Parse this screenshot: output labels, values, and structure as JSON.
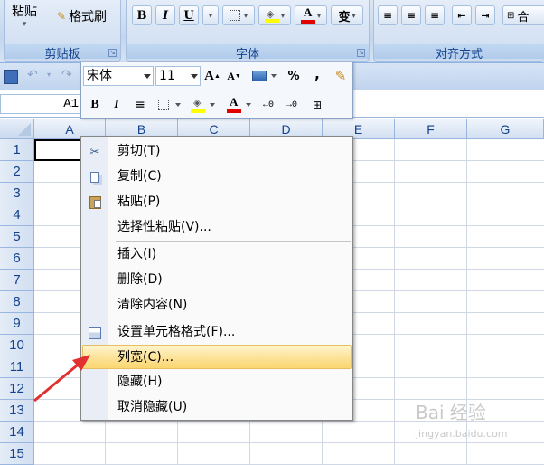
{
  "ribbon": {
    "paste_label": "粘贴",
    "format_painter_label": "格式刷",
    "clipboard_group": "剪贴板",
    "font_group": "字体",
    "align_group": "对齐方式",
    "merge_label": "合",
    "bold": "B",
    "italic": "I",
    "underline": "U",
    "font_color_letter": "A",
    "phonetic_letter": "变"
  },
  "minitoolbar": {
    "font_name": "宋体",
    "font_size": "11",
    "grow_font": "A",
    "shrink_font": "A",
    "percent": "%",
    "comma": ",",
    "bold": "B",
    "italic": "I",
    "font_color_letter": "A",
    "inc_decimal": "←0",
    "dec_decimal": "→0"
  },
  "namebox": {
    "value": "A1"
  },
  "columns": [
    "A",
    "B",
    "C",
    "D",
    "E",
    "F",
    "G"
  ],
  "rows": [
    "1",
    "2",
    "3",
    "4",
    "5",
    "6",
    "7",
    "8",
    "9",
    "10",
    "11",
    "12",
    "13",
    "14",
    "15"
  ],
  "context_menu": {
    "items": [
      {
        "label": "剪切(T)",
        "icon": "scissors-icon"
      },
      {
        "label": "复制(C)",
        "icon": "copy-icon"
      },
      {
        "label": "粘贴(P)",
        "icon": "paste-icon"
      },
      {
        "label": "选择性粘贴(V)...",
        "icon": ""
      },
      {
        "label": "插入(I)",
        "icon": ""
      },
      {
        "label": "删除(D)",
        "icon": ""
      },
      {
        "label": "清除内容(N)",
        "icon": ""
      },
      {
        "label": "设置单元格格式(F)...",
        "icon": "format-cells-icon"
      },
      {
        "label": "列宽(C)...",
        "icon": "",
        "highlighted": true
      },
      {
        "label": "隐藏(H)",
        "icon": ""
      },
      {
        "label": "取消隐藏(U)",
        "icon": ""
      }
    ]
  },
  "watermark": {
    "text": "Bai 经验",
    "sub": "jingyan.baidu.com"
  },
  "colors": {
    "accent_red": "#e03030",
    "font_color_bar": "#e00000",
    "highlight_bar": "#ffff00",
    "selected_col": "#f8b44a"
  }
}
